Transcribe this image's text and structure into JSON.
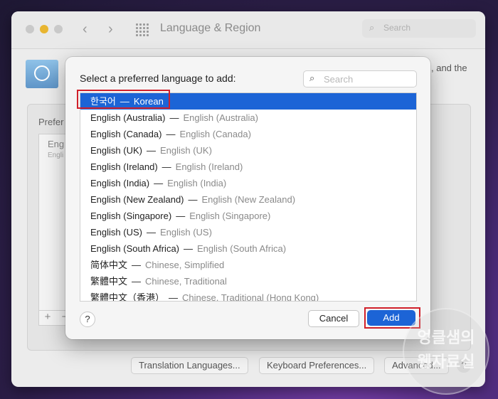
{
  "window": {
    "title": "Language & Region",
    "search_placeholder": "Search",
    "background_text": ", and the",
    "preferred_label": "Prefer",
    "preferred_entry_primary": "Eng",
    "preferred_entry_secondary": "Engli",
    "plus_symbol": "+",
    "minus_symbol": "−",
    "bottom_buttons": [
      "Translation Languages...",
      "Keyboard Preferences...",
      "Advanced..."
    ],
    "bottom_help": "?"
  },
  "sheet": {
    "title": "Select a preferred language to add:",
    "search_placeholder": "Search",
    "languages": [
      {
        "native": "한국어",
        "english": "Korean",
        "selected": true
      },
      {
        "native": "English (Australia)",
        "english": "English (Australia)"
      },
      {
        "native": "English (Canada)",
        "english": "English (Canada)"
      },
      {
        "native": "English (UK)",
        "english": "English (UK)"
      },
      {
        "native": "English (Ireland)",
        "english": "English (Ireland)"
      },
      {
        "native": "English (India)",
        "english": "English (India)"
      },
      {
        "native": "English (New Zealand)",
        "english": "English (New Zealand)"
      },
      {
        "native": "English (Singapore)",
        "english": "English (Singapore)"
      },
      {
        "native": "English (US)",
        "english": "English (US)"
      },
      {
        "native": "English (South Africa)",
        "english": "English (South Africa)"
      },
      {
        "native": "简体中文",
        "english": "Chinese, Simplified"
      },
      {
        "native": "繁體中文",
        "english": "Chinese, Traditional"
      },
      {
        "native": "繁體中文（香港）",
        "english": "Chinese, Traditional (Hong Kong)"
      }
    ],
    "separator": "—",
    "help_label": "?",
    "cancel_label": "Cancel",
    "add_label": "Add"
  },
  "watermark": {
    "line1": "엉클샘의",
    "line2": "웹자료실"
  },
  "colors": {
    "accent": "#1c64d6",
    "highlight_box": "#d0202a"
  }
}
